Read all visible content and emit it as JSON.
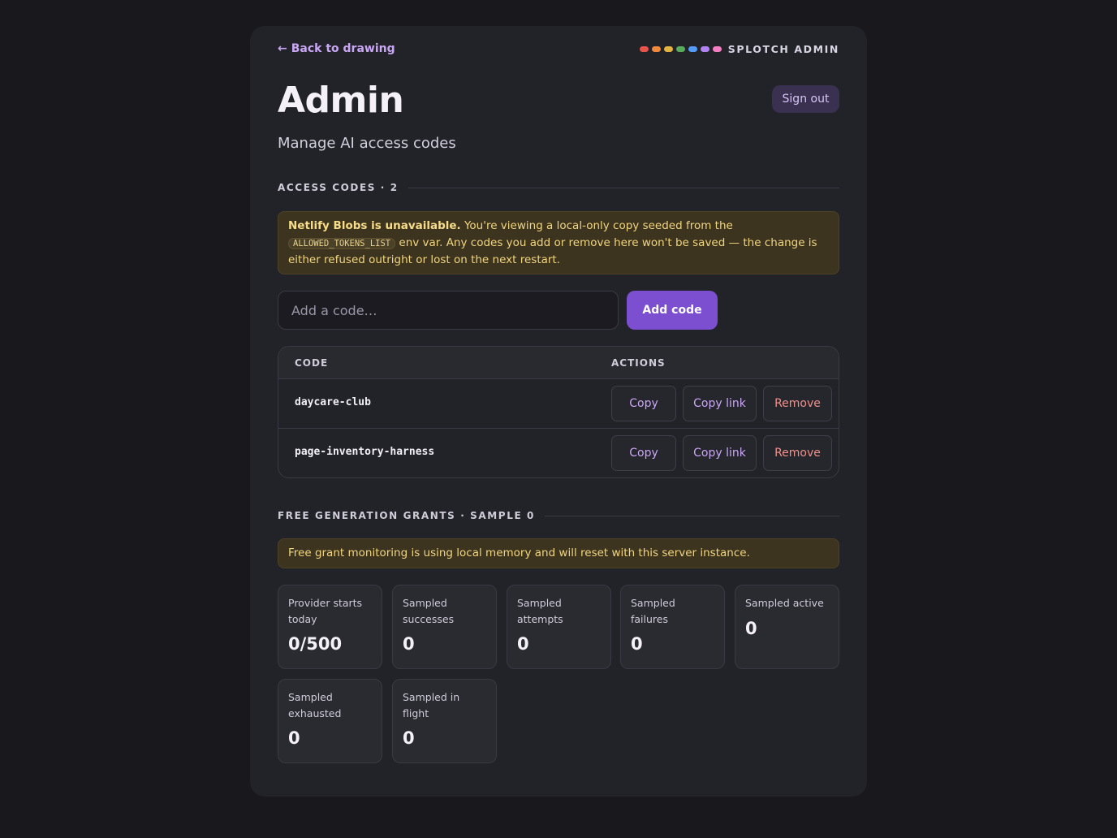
{
  "nav": {
    "back_label": "Back to drawing",
    "back_arrow": "←"
  },
  "brand": {
    "name": "SPLOTCH ADMIN",
    "dot_colors": [
      "#e5534b",
      "#f0883e",
      "#e3b341",
      "#57ab5a",
      "#539bf5",
      "#b083f0",
      "#f47fc0"
    ]
  },
  "header": {
    "title": "Admin",
    "subtitle": "Manage AI access codes",
    "signout_label": "Sign out"
  },
  "access_codes": {
    "section_title": "ACCESS CODES · 2",
    "warning_bold": "Netlify Blobs is unavailable.",
    "warning_text_1": " You're viewing a local-only copy seeded from the ",
    "warning_code": "ALLOWED_TOKENS_LIST",
    "warning_text_2": " env var. Any codes you add or remove here won't be saved — the change is either refused outright or lost on the next restart.",
    "input_placeholder": "Add a code…",
    "add_label": "Add code",
    "col_code": "CODE",
    "col_actions": "ACTIONS",
    "copy_label": "Copy",
    "copy_link_label": "Copy link",
    "remove_label": "Remove",
    "rows": [
      {
        "code": "daycare-club"
      },
      {
        "code": "page-inventory-harness"
      }
    ]
  },
  "grants": {
    "section_title": "FREE GENERATION GRANTS · SAMPLE 0",
    "notice": "Free grant monitoring is using local memory and will reset with this server instance.",
    "stats": [
      {
        "label": "Provider starts today",
        "value": "0/500"
      },
      {
        "label": "Sampled successes",
        "value": "0"
      },
      {
        "label": "Sampled attempts",
        "value": "0"
      },
      {
        "label": "Sampled failures",
        "value": "0"
      },
      {
        "label": "Sampled active",
        "value": "0"
      },
      {
        "label": "Sampled exhausted",
        "value": "0"
      },
      {
        "label": "Sampled in flight",
        "value": "0"
      }
    ]
  }
}
